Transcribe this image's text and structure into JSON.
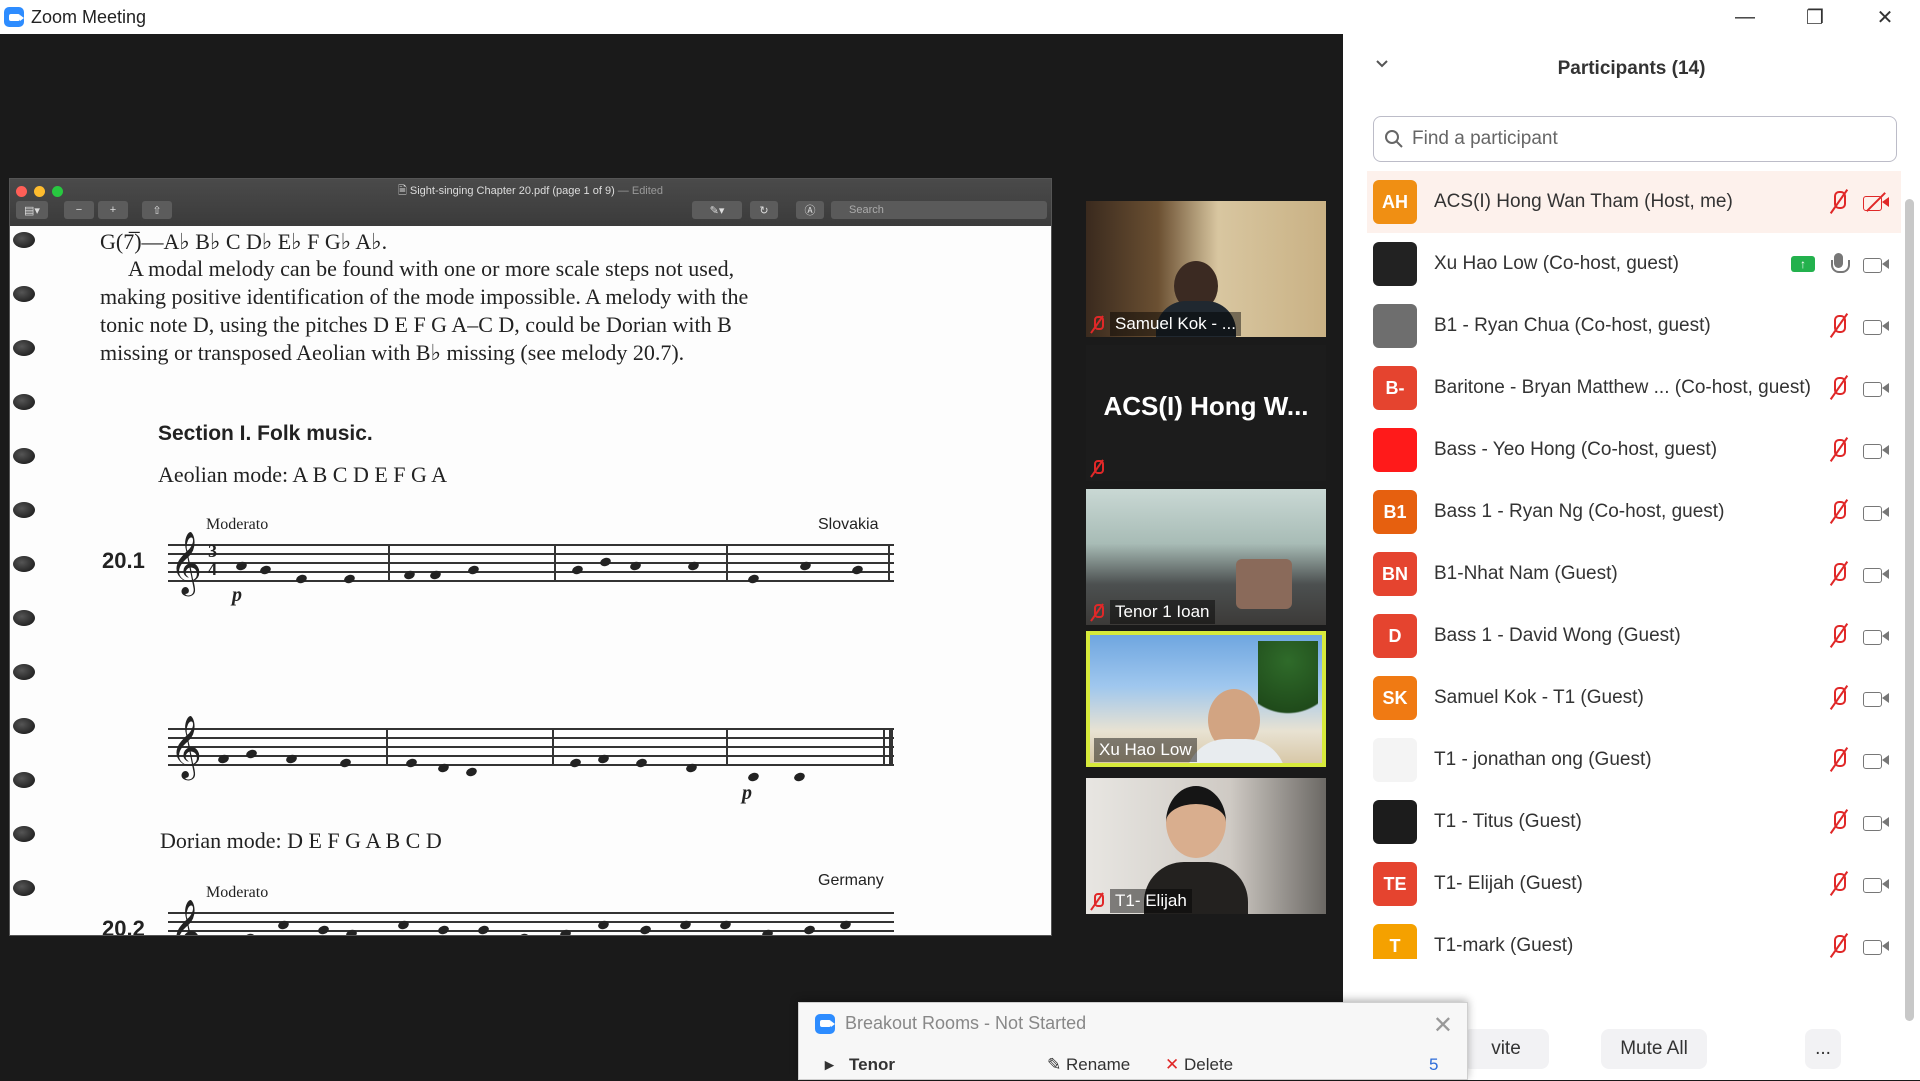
{
  "app": {
    "title": "Zoom Meeting"
  },
  "pdf": {
    "title": "Sight-singing Chapter 20.pdf (page 1 of 9)",
    "edited": "— Edited",
    "search_placeholder": "Search",
    "text_lines": [
      "G(7̅)—A♭ B♭ C D♭ E♭ F G♭ A♭.",
      "A modal melody can be found with one or more scale steps not used,",
      "making positive identification of the mode impossible. A melody with the",
      "tonic note D, using the pitches D E F G A–C D, could be Dorian with B",
      "missing or transposed Aeolian with B♭ missing (see melody 20.7)."
    ],
    "section_heading": "Section I. Folk music.",
    "aeolian_label": "Aeolian mode: A B C D E F G A",
    "moderato_1": "Moderato",
    "origin_1": "Slovakia",
    "number_1": "20.1",
    "dynamic_p1": "p",
    "dynamic_p2": "p",
    "dorian_label": "Dorian mode: D E F G A B C D",
    "moderato_2": "Moderato",
    "origin_2": "Germany",
    "number_2": "20.2"
  },
  "gallery": [
    {
      "name": "Samuel Kok - ...",
      "muted": true
    },
    {
      "name": "ACS(I) Hong W...",
      "muted": true
    },
    {
      "name": "Tenor 1 Ioan",
      "muted": true
    },
    {
      "name": "Xu Hao Low",
      "muted": false,
      "active": true
    },
    {
      "name": "T1- Elijah",
      "muted": true
    }
  ],
  "participants": {
    "title": "Participants (14)",
    "search_placeholder": "Find a participant",
    "list": [
      {
        "initials": "AH",
        "color": "#f08f13",
        "name": "ACS(I) Hong Wan Tham (Host, me)",
        "mic": "off",
        "cam": "off"
      },
      {
        "initials": "",
        "color": "#222222",
        "name": "Xu Hao Low (Co-host, guest)",
        "mic": "on",
        "cam": "on",
        "sharing": true
      },
      {
        "initials": "",
        "color": "#6e6e6e",
        "name": "B1 - Ryan Chua (Co-host, guest)",
        "mic": "off",
        "cam": "on"
      },
      {
        "initials": "B-",
        "color": "#e5442f",
        "name": "Baritone - Bryan Matthew ...  (Co-host, guest)",
        "mic": "off",
        "cam": "on"
      },
      {
        "initials": "",
        "color": "#ff1a1a",
        "name": "Bass - Yeo Hong (Co-host, guest)",
        "mic": "off",
        "cam": "on"
      },
      {
        "initials": "B1",
        "color": "#e6600f",
        "name": "Bass 1 - Ryan Ng (Co-host, guest)",
        "mic": "off",
        "cam": "on"
      },
      {
        "initials": "BN",
        "color": "#e5442f",
        "name": "B1-Nhat Nam (Guest)",
        "mic": "off",
        "cam": "on"
      },
      {
        "initials": "D",
        "color": "#e5442f",
        "name": "Bass 1 - David Wong (Guest)",
        "mic": "off",
        "cam": "on"
      },
      {
        "initials": "SK",
        "color": "#f07a13",
        "name": "Samuel Kok - T1 (Guest)",
        "mic": "off",
        "cam": "on"
      },
      {
        "initials": "",
        "color": "#f4f4f4",
        "name": "T1 - jonathan ong (Guest)",
        "mic": "off",
        "cam": "on"
      },
      {
        "initials": "",
        "color": "#1c1c1c",
        "name": "T1 - Titus (Guest)",
        "mic": "off",
        "cam": "on"
      },
      {
        "initials": "TE",
        "color": "#e5442f",
        "name": "T1- Elijah (Guest)",
        "mic": "off",
        "cam": "on"
      },
      {
        "initials": "T",
        "color": "#f5a100",
        "name": "T1-mark (Guest)",
        "mic": "off",
        "cam": "on"
      }
    ],
    "footer": {
      "invite": "vite",
      "mute_all": "Mute All",
      "more": "..."
    }
  },
  "breakout": {
    "title": "Breakout Rooms - Not Started",
    "room_name": "Tenor",
    "rename": "Rename",
    "delete": "Delete",
    "count": "5"
  },
  "colors": {
    "accent": "#2d8cff",
    "mute_red": "#e02828",
    "active_border": "#d7ea3b",
    "share_green": "#23b14d"
  }
}
